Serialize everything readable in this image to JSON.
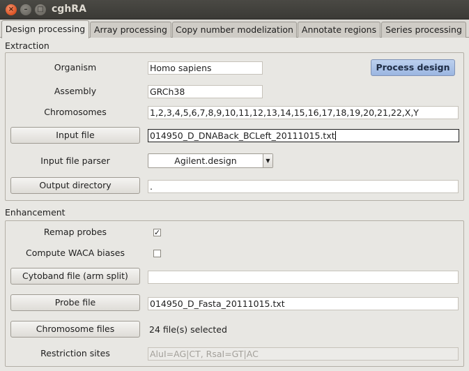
{
  "window": {
    "title": "cghRA"
  },
  "tabs": [
    "Design processing",
    "Array processing",
    "Copy number modelization",
    "Annotate regions",
    "Series processing"
  ],
  "extraction": {
    "section_label": "Extraction",
    "organism_label": "Organism",
    "organism_value": "Homo sapiens",
    "process_button": "Process design",
    "assembly_label": "Assembly",
    "assembly_value": "GRCh38",
    "chromosomes_label": "Chromosomes",
    "chromosomes_value": "1,2,3,4,5,6,7,8,9,10,11,12,13,14,15,16,17,18,19,20,21,22,X,Y",
    "input_file_button": "Input file",
    "input_file_value": "014950_D_DNABack_BCLeft_20111015.txt",
    "parser_label": "Input file parser",
    "parser_value": "Agilent.design",
    "output_dir_button": "Output directory",
    "output_dir_value": "."
  },
  "enhancement": {
    "section_label": "Enhancement",
    "remap_label": "Remap probes",
    "remap_checked": true,
    "waca_label": "Compute WACA biases",
    "waca_checked": false,
    "cytoband_button": "Cytoband file (arm split)",
    "cytoband_value": "",
    "probe_button": "Probe file",
    "probe_value": "014950_D_Fasta_20111015.txt",
    "chrom_files_button": "Chromosome files",
    "chrom_files_status": "24 file(s) selected",
    "restriction_label": "Restriction sites",
    "restriction_value": "AluI=AG|CT, RsaI=GT|AC"
  },
  "colors": {
    "accent_button": "#a9c1e8",
    "close_button": "#e05a2c"
  }
}
